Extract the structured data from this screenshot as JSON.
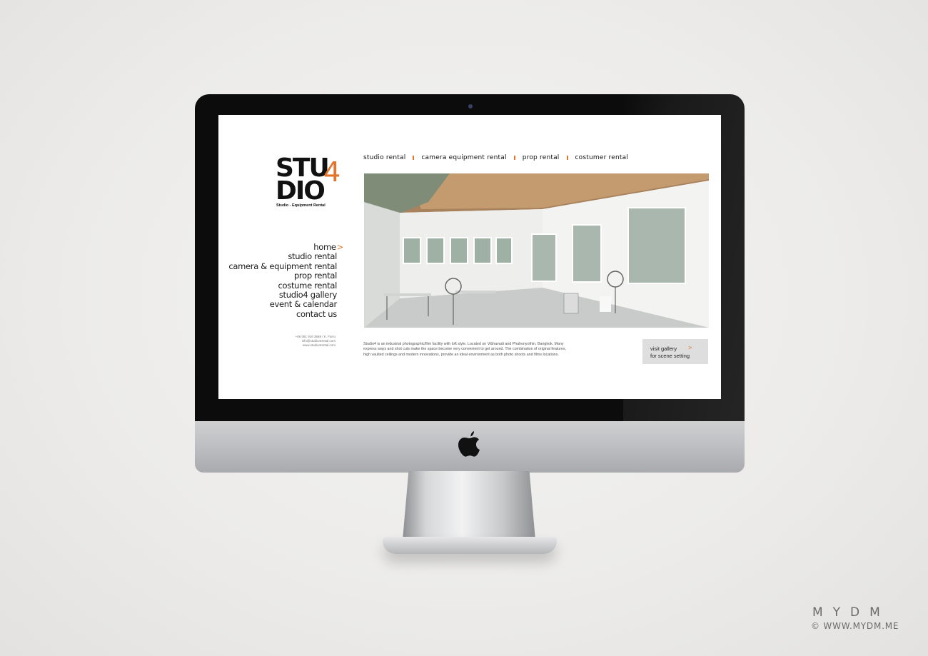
{
  "logo": {
    "line1": "STU",
    "line2": "DIO",
    "four": "4",
    "tagline": "Studio - Equipment Rental"
  },
  "top_nav": [
    "studio rental",
    "camera equipment rental",
    "prop rental",
    "costumer rental"
  ],
  "side_nav": {
    "home": "home",
    "home_arrow": ">",
    "items": [
      "studio rental",
      "camera & equipment rental",
      "prop rental",
      "costume rental",
      "studio4 gallery",
      "event & calendar",
      "contact us"
    ]
  },
  "contact": {
    "phone": "+66 081 916 3669 / K. Farru",
    "email": "info@studio4rental.com",
    "web": "www.studio4rental.com"
  },
  "description": "Studio4 is an industrial photographic/film facility with loft style. Located on Vibhavadi and Phahonyothin, Bangkok. Many express ways and shot cuts make the space become very convenient to get around. The combination of original features, high vaulted ceilings and modern innovations, provide an ideal environment as both photo shoots and films locations.",
  "gallery_button": {
    "line1": "visit gallery",
    "line2": "for scene setting",
    "arrow": ">"
  },
  "watermark": {
    "brand": "MYDM",
    "copyright": "© WWW.MYDM.ME"
  },
  "colors": {
    "accent": "#e3742b",
    "bezel": "#0c0c0c"
  }
}
